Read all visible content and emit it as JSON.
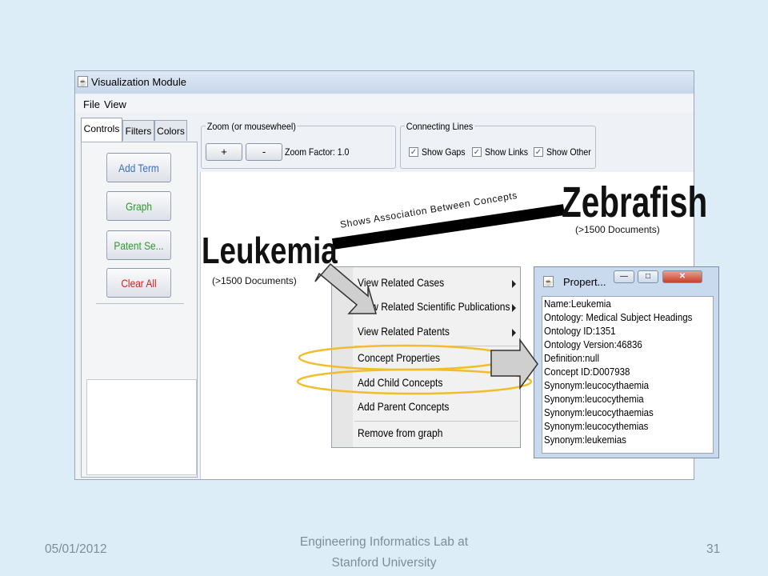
{
  "window": {
    "title": "Visualization Module",
    "menu": [
      "File",
      "View"
    ]
  },
  "left_panel": {
    "tabs": [
      "Controls",
      "Filters",
      "Colors"
    ],
    "buttons": [
      "Add Term",
      "Graph",
      "Patent Se...",
      "Clear All"
    ],
    "button_colors": [
      "#3a6fc4",
      "#2e9a2e",
      "#2e9a2e",
      "#d42020"
    ]
  },
  "zoom": {
    "group_label": "Zoom (or mousewheel)",
    "plus": "+",
    "minus": "-",
    "factor_text": "Zoom Factor: 1.0"
  },
  "connecting_lines": {
    "group_label": "Connecting Lines",
    "options": [
      "Show Gaps",
      "Show Links",
      "Show Other"
    ],
    "checked": [
      true,
      true,
      true
    ]
  },
  "graph": {
    "node1": {
      "term": "Leukemia",
      "docs": "(>1500 Documents)"
    },
    "node2": {
      "term": "Zebrafish",
      "docs": "(>1500 Documents)"
    },
    "link_label": "Shows Association Between Concepts"
  },
  "context_menu": {
    "items": [
      "View Related Cases",
      "View Related Scientific Publications",
      "View Related Patents",
      "Concept Properties",
      "Add Child Concepts",
      "Add Parent Concepts",
      "Remove from graph"
    ],
    "highlighted": [
      "Concept Properties",
      "Add Child Concepts"
    ],
    "highlight_color": "#f0be2c"
  },
  "properties_dialog": {
    "title": "Propert...",
    "lines": [
      "Name:Leukemia",
      "Ontology: Medical Subject Headings",
      "Ontology ID:1351",
      "Ontology Version:46836",
      "Definition:null",
      "Concept ID:D007938",
      "Synonym:leucocythaemia",
      "Synonym:leucocythemia",
      "Synonym:leucocythaemias",
      "Synonym:leucocythemias",
      "Synonym:leukemias"
    ]
  },
  "footer": {
    "date": "05/01/2012",
    "center_line1": "Engineering Informatics Lab at",
    "center_line2": "Stanford University",
    "page": "31"
  }
}
